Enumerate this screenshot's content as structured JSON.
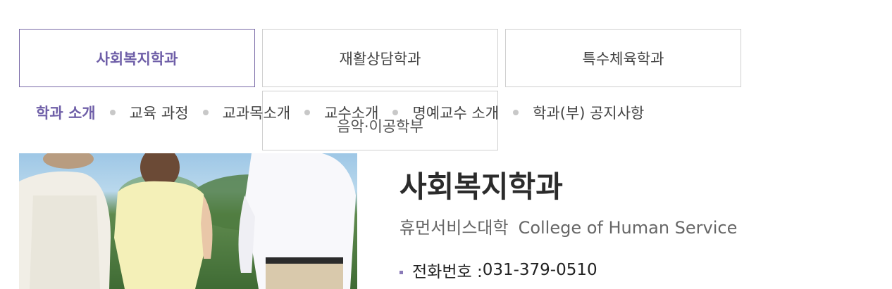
{
  "department_tabs": [
    {
      "label": "사회복지학과",
      "active": true
    },
    {
      "label": "재활상담학과",
      "active": false
    },
    {
      "label": "특수체육학과",
      "active": false
    },
    {
      "label": "음악·이공학부",
      "active": false
    }
  ],
  "subnav": {
    "items": [
      "학과 소개",
      "교육 과정",
      "교과목소개",
      "교수소개",
      "명예교수 소개",
      "학과(부) 공지사항"
    ],
    "active_index": 0
  },
  "department": {
    "title": "사회복지학과",
    "college_ko": "휴먼서비스대학",
    "college_en": "College of Human Service",
    "phone_label": "전화번호 : ",
    "phone": "031-379-0510"
  },
  "colors": {
    "accent": "#6f5fa8",
    "tab_border": "#cfcfcf",
    "dot": "#c8c8c8"
  }
}
